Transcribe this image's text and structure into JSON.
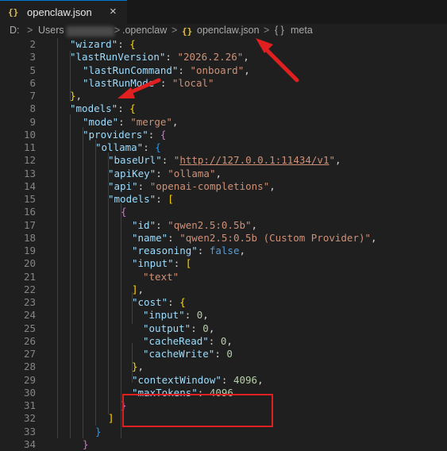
{
  "tab": {
    "icon": "{}",
    "label": "openclaw.json",
    "close": "×"
  },
  "breadcrumb": {
    "drive": "D:",
    "users": "Users",
    "folder": ".openclaw",
    "file_icon": "{}",
    "file": "openclaw.json",
    "symbol_icon": "{ }",
    "symbol": "meta",
    "separator": ">"
  },
  "editor": {
    "line_numbers": [
      "2",
      "3",
      "5",
      "6",
      "7",
      "8",
      "9",
      "10",
      "11",
      "12",
      "13",
      "14",
      "15",
      "16",
      "17",
      "18",
      "19",
      "20",
      "21",
      "22",
      "23",
      "24",
      "25",
      "26",
      "27",
      "28",
      "29",
      "30",
      "31",
      "32",
      "33",
      "34"
    ],
    "lines": [
      [
        [
          "k",
          "\"wizard\""
        ],
        [
          "p",
          ": "
        ],
        [
          "y",
          "{"
        ]
      ],
      [
        [
          "k",
          "\"lastRunVersion\""
        ],
        [
          "p",
          ": "
        ],
        [
          "s",
          "\"2026.2.26\""
        ],
        [
          "p",
          ","
        ]
      ],
      [
        [
          "k",
          "\"lastRunCommand\""
        ],
        [
          "p",
          ": "
        ],
        [
          "s",
          "\"onboard\""
        ],
        [
          "p",
          ","
        ]
      ],
      [
        [
          "k",
          "\"lastRunMode\""
        ],
        [
          "p",
          ": "
        ],
        [
          "s",
          "\"local\""
        ]
      ],
      [
        [
          "y",
          "}"
        ],
        [
          "p",
          ","
        ]
      ],
      [
        [
          "k",
          "\"models\""
        ],
        [
          "p",
          ": "
        ],
        [
          "y",
          "{"
        ]
      ],
      [
        [
          "k",
          "\"mode\""
        ],
        [
          "p",
          ": "
        ],
        [
          "s",
          "\"merge\""
        ],
        [
          "p",
          ","
        ]
      ],
      [
        [
          "k",
          "\"providers\""
        ],
        [
          "p",
          ": "
        ],
        [
          "m",
          "{"
        ]
      ],
      [
        [
          "k",
          "\"ollama\""
        ],
        [
          "p",
          ": "
        ],
        [
          "c",
          "{"
        ]
      ],
      [
        [
          "k",
          "\"baseUrl\""
        ],
        [
          "p",
          ": "
        ],
        [
          "s",
          "\""
        ],
        [
          "u",
          "http://127.0.0.1:11434/v1"
        ],
        [
          "s",
          "\""
        ],
        [
          "p",
          ","
        ]
      ],
      [
        [
          "k",
          "\"apiKey\""
        ],
        [
          "p",
          ": "
        ],
        [
          "s",
          "\"ollama\""
        ],
        [
          "p",
          ","
        ]
      ],
      [
        [
          "k",
          "\"api\""
        ],
        [
          "p",
          ": "
        ],
        [
          "s",
          "\"openai-completions\""
        ],
        [
          "p",
          ","
        ]
      ],
      [
        [
          "k",
          "\"models\""
        ],
        [
          "p",
          ": "
        ],
        [
          "y",
          "["
        ]
      ],
      [
        [
          "m",
          "{"
        ]
      ],
      [
        [
          "k",
          "\"id\""
        ],
        [
          "p",
          ": "
        ],
        [
          "s",
          "\"qwen2.5:0.5b\""
        ],
        [
          "p",
          ","
        ]
      ],
      [
        [
          "k",
          "\"name\""
        ],
        [
          "p",
          ": "
        ],
        [
          "s",
          "\"qwen2.5:0.5b (Custom Provider)\""
        ],
        [
          "p",
          ","
        ]
      ],
      [
        [
          "k",
          "\"reasoning\""
        ],
        [
          "p",
          ": "
        ],
        [
          "b",
          "false"
        ],
        [
          "p",
          ","
        ]
      ],
      [
        [
          "k",
          "\"input\""
        ],
        [
          "p",
          ": "
        ],
        [
          "y",
          "["
        ]
      ],
      [
        [
          "s",
          "\"text\""
        ]
      ],
      [
        [
          "y",
          "]"
        ],
        [
          "p",
          ","
        ]
      ],
      [
        [
          "k",
          "\"cost\""
        ],
        [
          "p",
          ": "
        ],
        [
          "y",
          "{"
        ]
      ],
      [
        [
          "k",
          "\"input\""
        ],
        [
          "p",
          ": "
        ],
        [
          "n",
          "0"
        ],
        [
          "p",
          ","
        ]
      ],
      [
        [
          "k",
          "\"output\""
        ],
        [
          "p",
          ": "
        ],
        [
          "n",
          "0"
        ],
        [
          "p",
          ","
        ]
      ],
      [
        [
          "k",
          "\"cacheRead\""
        ],
        [
          "p",
          ": "
        ],
        [
          "n",
          "0"
        ],
        [
          "p",
          ","
        ]
      ],
      [
        [
          "k",
          "\"cacheWrite\""
        ],
        [
          "p",
          ": "
        ],
        [
          "n",
          "0"
        ]
      ],
      [
        [
          "y",
          "}"
        ],
        [
          "p",
          ","
        ]
      ],
      [
        [
          "k",
          "\"contextWindow\""
        ],
        [
          "p",
          ": "
        ],
        [
          "n",
          "4096"
        ],
        [
          "p",
          ","
        ]
      ],
      [
        [
          "k",
          "\"maxTokens\""
        ],
        [
          "p",
          ": "
        ],
        [
          "n",
          "4096"
        ]
      ],
      [
        [
          "m",
          "}"
        ]
      ],
      [
        [
          "y",
          "]"
        ]
      ],
      [
        [
          "c",
          "}"
        ]
      ],
      [
        [
          "m",
          "}"
        ]
      ]
    ]
  },
  "colors": {
    "highlight_box": "#e02020",
    "arrow": "#e02020"
  }
}
